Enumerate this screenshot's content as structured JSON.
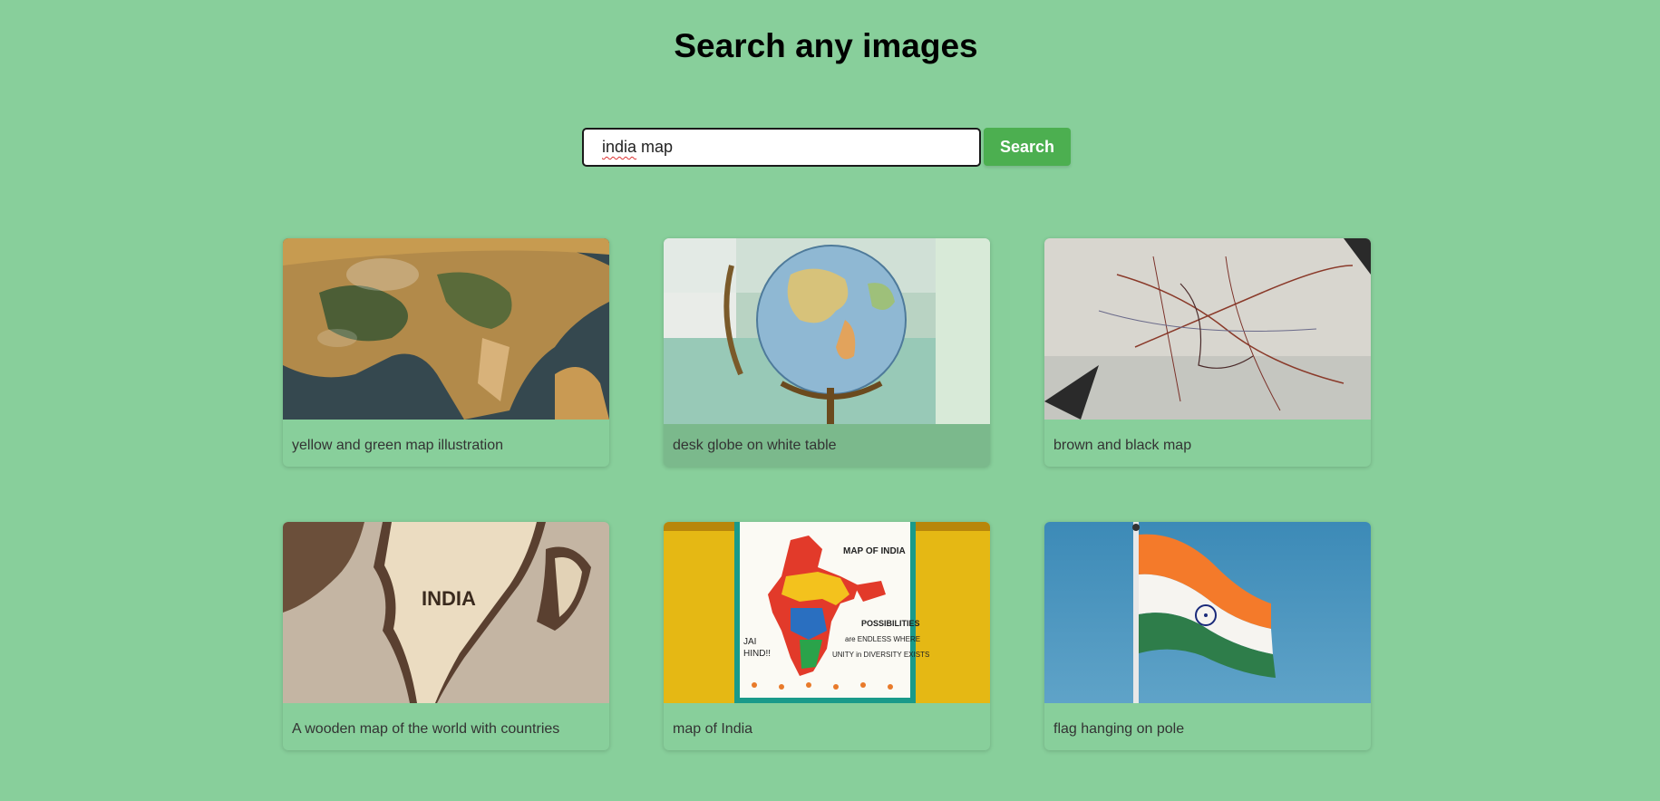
{
  "header": {
    "title": "Search any images"
  },
  "search": {
    "query_word1": "india",
    "query_rest": " map",
    "button_label": "Search"
  },
  "results": [
    {
      "caption": "yellow and green map illustration",
      "image_icon": "globe-asia-closeup"
    },
    {
      "caption": "desk globe on white table",
      "image_icon": "desk-globe"
    },
    {
      "caption": "brown and black map",
      "image_icon": "road-map"
    },
    {
      "caption": "A wooden map of the world with countries",
      "image_icon": "wooden-world-map",
      "image_text": "INDIA"
    },
    {
      "caption": "map of India",
      "image_icon": "india-map-poster",
      "poster_title": "MAP OF INDIA",
      "poster_line1": "POSSIBILITIES",
      "poster_line2": "are ENDLESS WHERE",
      "poster_line3": "UNITY in DIVERSITY EXISTS",
      "poster_side1": "JAI",
      "poster_side2": "HIND!!"
    },
    {
      "caption": "flag hanging on pole",
      "image_icon": "india-flag"
    }
  ],
  "colors": {
    "background": "#88cf9b",
    "button": "#4caf50",
    "hovered_card": "#7bb98c"
  }
}
